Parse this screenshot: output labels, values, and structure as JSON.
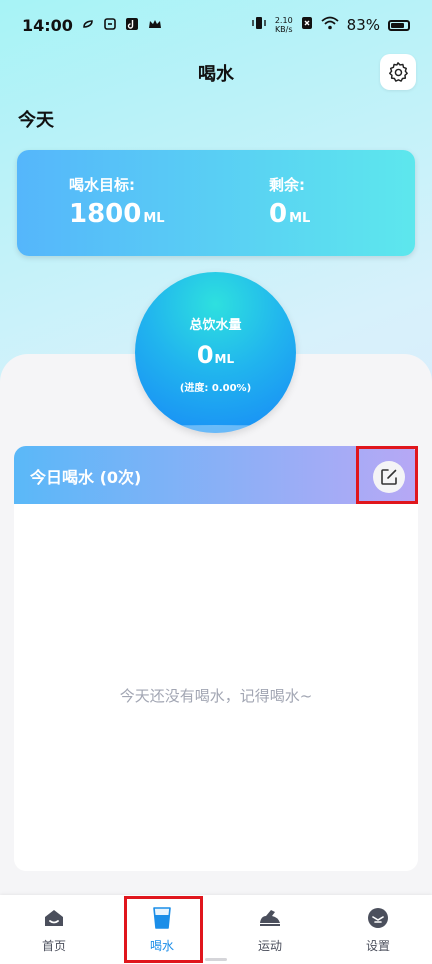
{
  "status_bar": {
    "time": "14:00",
    "net_speed_top": "2.10",
    "net_speed_bottom": "KB/s",
    "battery": "83%"
  },
  "header": {
    "title": "喝水",
    "settings_icon": "gear-icon"
  },
  "section": {
    "today": "今天"
  },
  "goal_card": {
    "goal_label": "喝水目标:",
    "goal_value": "1800",
    "goal_unit": "ML",
    "remaining_label": "剩余:",
    "remaining_value": "0",
    "remaining_unit": "ML"
  },
  "intake_circle": {
    "label": "总饮水量",
    "value": "0",
    "unit": "ML",
    "progress": "(进度: 0.00%)"
  },
  "records": {
    "title": "今日喝水 (0次)",
    "empty_text": "今天还没有喝水，记得喝水~"
  },
  "tabbar": {
    "tabs": [
      {
        "label": "首页",
        "icon": "home-icon"
      },
      {
        "label": "喝水",
        "icon": "water-cup-icon",
        "active": true
      },
      {
        "label": "运动",
        "icon": "sneaker-icon"
      },
      {
        "label": "设置",
        "icon": "settings-face-icon"
      }
    ]
  },
  "colors": {
    "accent": "#1b8ee8",
    "highlight_outline": "#e0161d",
    "empty_text": "#a2a6b3"
  }
}
